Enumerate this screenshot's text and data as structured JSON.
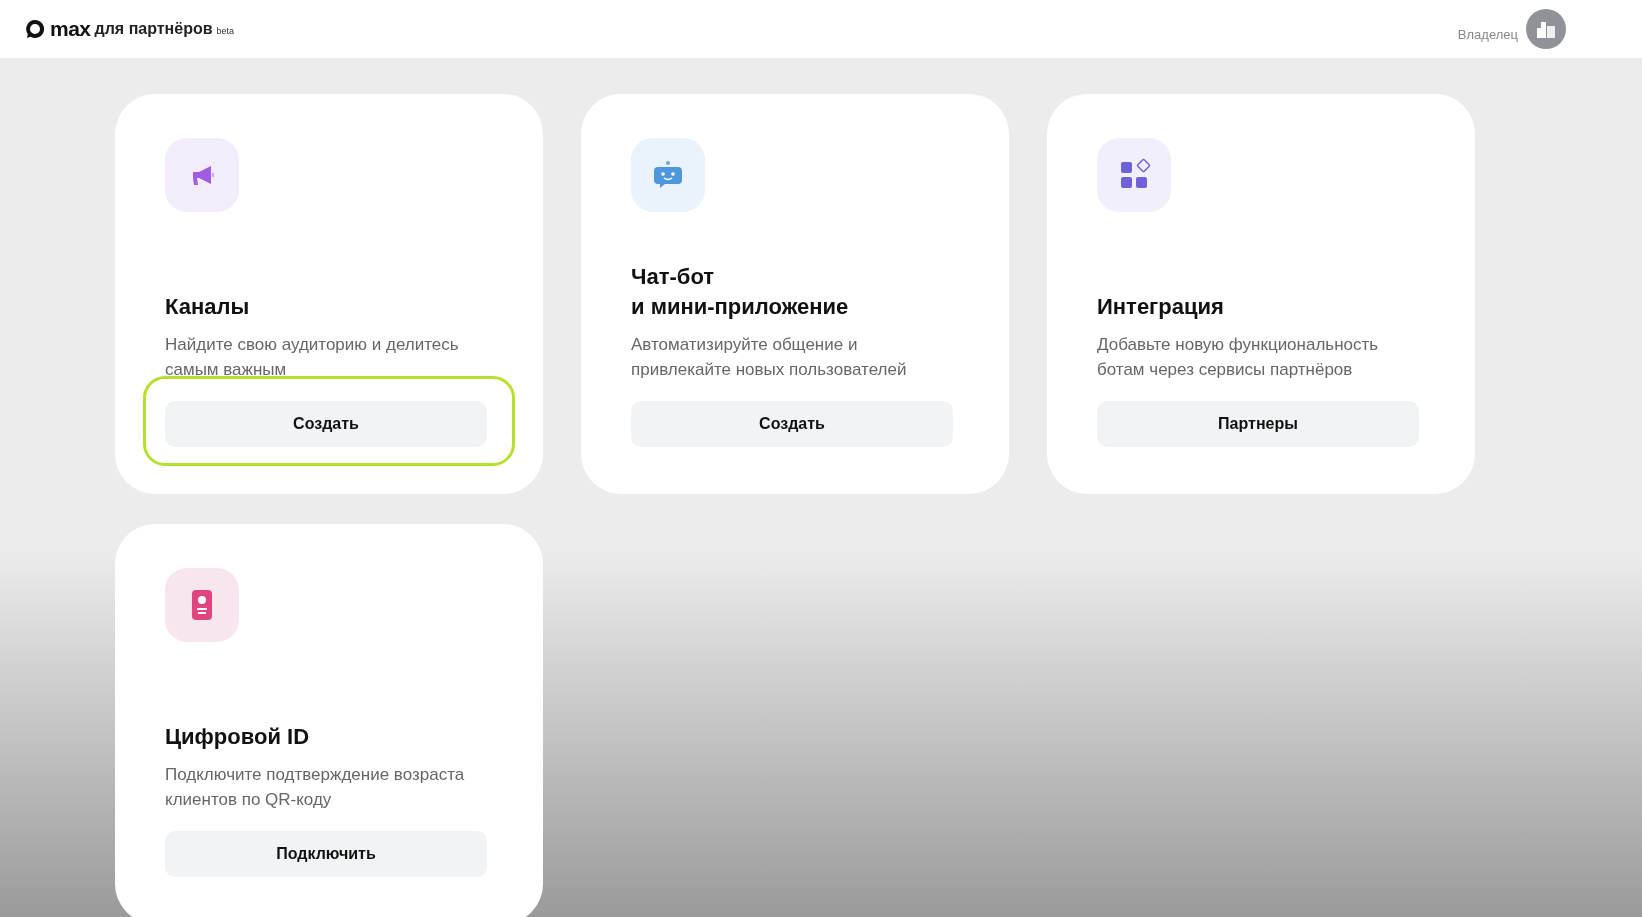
{
  "header": {
    "logo_text": "max",
    "logo_suffix": "для партнёров",
    "badge": "beta",
    "role": "Владелец"
  },
  "cards": [
    {
      "title": [
        "Каналы"
      ],
      "description": "Найдите свою аудиторию и делитесь самым важным",
      "button": "Создать",
      "highlighted": true
    },
    {
      "title": [
        "Чат-бот",
        "и мини-приложение"
      ],
      "description": "Автоматизируйте общение и привлекайте новых пользователей",
      "button": "Создать",
      "highlighted": false
    },
    {
      "title": [
        "Интеграция"
      ],
      "description": "Добавьте новую функциональность ботам через сервисы партнёров",
      "button": "Партнеры",
      "highlighted": false
    },
    {
      "title": [
        "Цифровой ID"
      ],
      "description": "Подключите подтверждение возраста клиентов по QR-коду",
      "button": "Подключить",
      "highlighted": false
    }
  ]
}
